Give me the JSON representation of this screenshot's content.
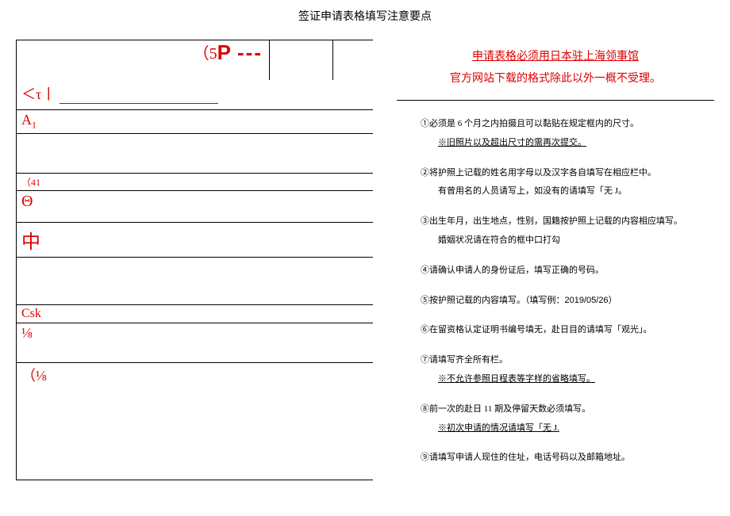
{
  "title": "签证申请表格填写注意要点",
  "notice": {
    "line1": "申请表格必须用日本驻上海领事馆",
    "line2": "官方网站下载的格式除此以外一概不受理。"
  },
  "form_labels": {
    "five": "（5",
    "p": "P",
    "dashes": "---",
    "tau_prefix": "＜τ",
    "tau_bar": "丨",
    "a1_a": "A",
    "a1_1": "1",
    "fortyone": "（41",
    "theta": "Θ",
    "zhong": "中",
    "csk": "Csk",
    "frac1": "⅛",
    "frac2": "（⅛"
  },
  "instructions": [
    {
      "num": "①",
      "text": "必须是 6 个月之内拍摄且可以黏贴在规定框内的尺寸。",
      "sub": "※旧照片以及超出尺寸的需再次提交。",
      "sub_underline": true
    },
    {
      "num": "②",
      "text": "将护照上记载的姓名用字母以及汉字各自填写在相应栏中。",
      "sub": "有曾用名的人员请写上，如没有的请填写「无 J。"
    },
    {
      "num": "③",
      "text": "出生年月，出生地点，性别，国籍按护照上记载的内容相应填写。",
      "sub": "婚姻状况请在符合的框中口打勾"
    },
    {
      "num": "④",
      "text": "请确认申请人的身份证后，填写正确的号码。"
    },
    {
      "num": "⑤",
      "text": "按护照记载的内容填写。（填写例：",
      "example": "2019/05/26",
      "tail": "）"
    },
    {
      "num": "⑥",
      "text": "在留资格认定证明书编号填无，赴日目的请填写「观光」。"
    },
    {
      "num": "⑦",
      "text": "请填写齐全所有栏。",
      "sub": "※不允许参照日程表等字样的省略填写。",
      "sub_underline": true
    },
    {
      "num": "⑧",
      "text": "前一次的赴日 11 期及停留天数必须填写。",
      "sub": "※初次申请的情况请填写「无 J.",
      "sub_underline": true
    },
    {
      "num": "⑨",
      "text": "请填写申请人现住的住址，电话号码以及邮箱地址。"
    }
  ]
}
